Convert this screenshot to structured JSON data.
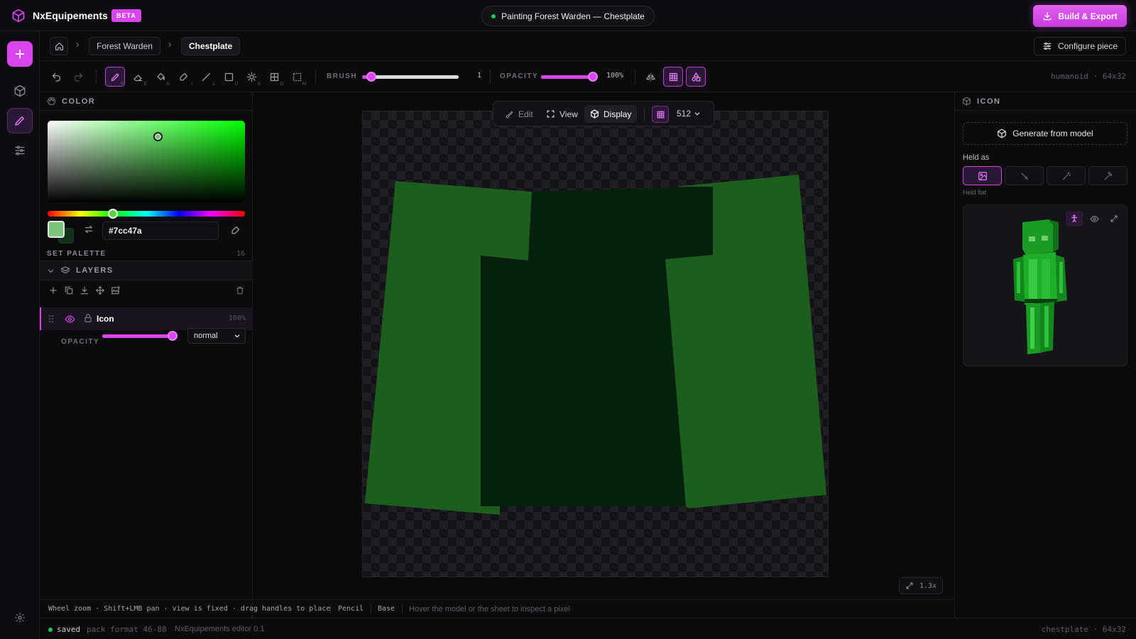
{
  "app": {
    "name": "NxEquipements",
    "badge": "BETA"
  },
  "session": {
    "status": "Painting Forest Warden — Chestplate"
  },
  "actions": {
    "build_export": "Build & Export",
    "configure": "Configure piece"
  },
  "breadcrumb": {
    "items": [
      "Forest Warden",
      "Chestplate"
    ]
  },
  "toolbar": {
    "tools": [
      {
        "name": "pencil",
        "key": "B"
      },
      {
        "name": "eraser",
        "key": "E"
      },
      {
        "name": "fill",
        "key": "G"
      },
      {
        "name": "picker",
        "key": "I"
      },
      {
        "name": "line",
        "key": "L"
      },
      {
        "name": "rect",
        "key": "U"
      },
      {
        "name": "lighten",
        "key": "S"
      },
      {
        "name": "grid",
        "key": "O"
      },
      {
        "name": "select",
        "key": "M"
      }
    ],
    "brush_label": "BRUSH",
    "brush_value": "1",
    "brush_level": 0.05,
    "opacity_label": "OPACITY",
    "opacity_value": "100%",
    "opacity_level": 1.0,
    "meta": "humanoid · 64x32"
  },
  "color_panel": {
    "title": "COLOR",
    "hex": "#7cc47a",
    "primary": "#7cc47a",
    "secondary": "#0f3415",
    "palette_label": "SET PALETTE",
    "palette_count": "16"
  },
  "layers_panel": {
    "title": "LAYERS",
    "layer": {
      "name": "Icon",
      "opacity": "100%"
    },
    "opacity_label": "OPACITY",
    "opacity_level": 1.0,
    "blend": "normal"
  },
  "canvas": {
    "modes": [
      "Edit",
      "View",
      "Display"
    ],
    "active_mode": "Display",
    "resolution": "512",
    "zoom": "1.3x"
  },
  "icon_panel": {
    "title": "ICON",
    "generate": "Generate from model",
    "held_label": "Held as",
    "held_sub": "Held flat"
  },
  "hint": {
    "keys": "Wheel zoom · Shift+LMB pan · view is fixed · drag handles to place",
    "tool": "Pencil",
    "layer": "Base",
    "inspect": "Hover the model or the sheet to inspect a pixel"
  },
  "status": {
    "saved": "saved",
    "pack": "pack format 46-88",
    "editor": "NxEquipements editor 0.1",
    "right": "chestplate · 64x32"
  },
  "colors": {
    "accent": "#d946ef",
    "armor_light": "#1d5e1e",
    "armor_dark": "#05200b"
  }
}
